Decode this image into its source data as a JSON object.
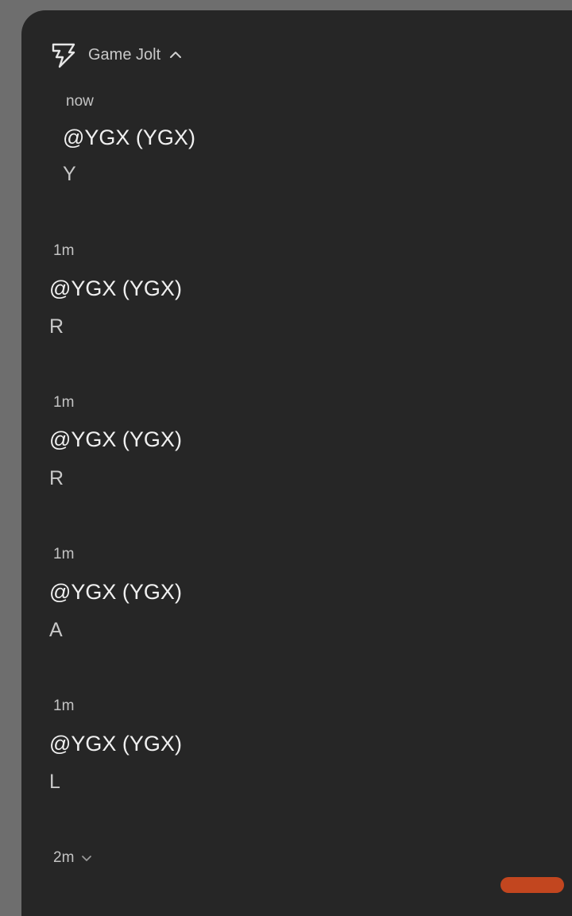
{
  "header": {
    "app_name": "Game Jolt",
    "icon": "game-jolt-icon",
    "toggle_icon": "chevron-up-icon"
  },
  "notifications": [
    {
      "time": "now",
      "title": "@YGX (YGX)",
      "body": "Y"
    },
    {
      "time": "1m",
      "title": "@YGX (YGX)",
      "body": "R"
    },
    {
      "time": "1m",
      "title": "@YGX (YGX)",
      "body": "R"
    },
    {
      "time": "1m",
      "title": "@YGX (YGX)",
      "body": "A"
    },
    {
      "time": "1m",
      "title": "@YGX (YGX)",
      "body": "L"
    }
  ],
  "last_group": {
    "time": "2m",
    "expand_icon": "chevron-down-icon"
  },
  "colors": {
    "background": "#262626",
    "outer": "#6e6e6e",
    "accent": "#c2461f"
  }
}
